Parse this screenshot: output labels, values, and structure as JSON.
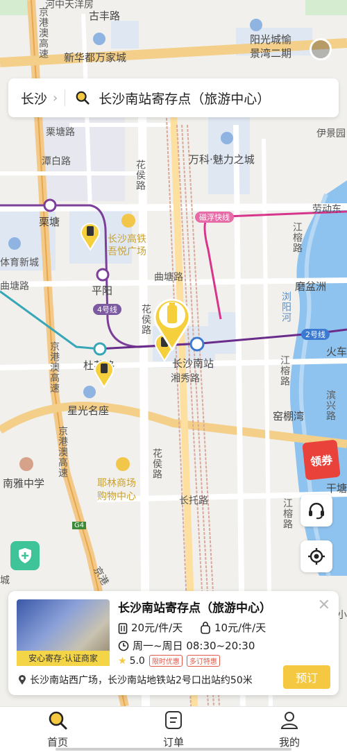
{
  "map": {
    "labels": {
      "top_partial": "河中天洋房",
      "gufeng_road": "古丰路",
      "yangguang": "阳光城愉",
      "jingwan": "景湾二期",
      "xinhuadu": "新华都万家城",
      "chang_partial": "长沙",
      "jinggangao_top": "京港澳高速",
      "litang_road": "栗塘路",
      "tanbai_road": "潭白路",
      "huahou_road1": "花侯路",
      "wanke": "万科·魅力之城",
      "yijing": "伊景园",
      "litang": "栗塘",
      "cixuan": "磁浮快线",
      "laodong": "劳动东",
      "hsr_plaza1": "长沙高铁",
      "hsr_plaza2": "吾悦广场",
      "ti_yu": "体育新城",
      "jianglu": "江榕路",
      "qutang_w": "曲塘路",
      "pingyang": "平阳",
      "qutang_e": "曲塘路",
      "mopen": "磨盆洲",
      "liuyang_river": "浏阳河",
      "line4": "4号线",
      "huahou_road2": "花侯路",
      "line2": "2号线",
      "huoche": "火车",
      "jinggangao_mid": "京港澳高速",
      "du_road": "杜花路",
      "changsha_south": "长沙南站",
      "xiangxiu": "湘秀路",
      "jianglu2": "江榕路",
      "binxing": "滨兴路",
      "xingguang": "星光名座",
      "yaopeng": "窑棚湾",
      "jinggangao_low": "京港澳高速",
      "nanya": "南雅中学",
      "yelin1": "耶林商场",
      "yelin2": "购物中心",
      "huahou_road3": "花侯路",
      "changtuo": "长托路",
      "jianglu3": "江榕路",
      "qiantang": "干塘",
      "g4": "G4",
      "jinggangao_bottom": "京港",
      "cheng": "城",
      "xiao": "小"
    },
    "coupon_label": "领券"
  },
  "search": {
    "city": "长沙",
    "query": "长沙南站寄存点（旅游中心）"
  },
  "card": {
    "title": "长沙南站寄存点（旅游中心）",
    "thumb_tag": "安心寄存·认证商家",
    "price_large": "20元/件/天",
    "price_small": "10元/件/天",
    "hours": "周一~周日 08:30~20:30",
    "rating": "5.0",
    "tag1": "限时优惠",
    "tag2": "多订特惠",
    "address": "长沙南站西广场，长沙南站地铁站2号口出站约50米",
    "book_label": "预订"
  },
  "tabs": [
    {
      "label": "首页"
    },
    {
      "label": "订单"
    },
    {
      "label": "我的"
    }
  ],
  "colors": {
    "accent": "#f5c842",
    "line4": "#7b3f9a",
    "line2": "#6a2c8a",
    "maglev": "#d6358b",
    "river": "#3b8fe0"
  }
}
